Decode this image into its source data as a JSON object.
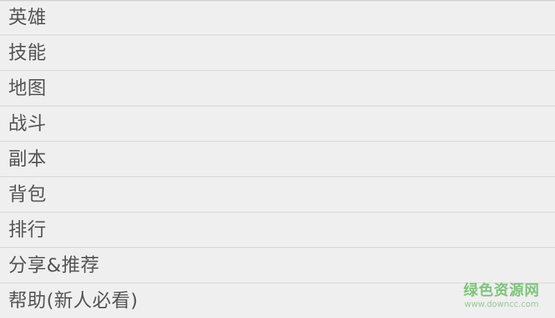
{
  "menu": {
    "items": [
      {
        "label": "英雄"
      },
      {
        "label": "技能"
      },
      {
        "label": "地图"
      },
      {
        "label": "战斗"
      },
      {
        "label": "副本"
      },
      {
        "label": "背包"
      },
      {
        "label": "排行"
      },
      {
        "label": "分享&推荐"
      },
      {
        "label": "帮助(新人必看)"
      }
    ]
  },
  "watermark": {
    "title": "绿色资源网",
    "url": "www.downcc.com"
  },
  "colors": {
    "background": "#efefef",
    "divider": "#d3d3d3",
    "text": "#555555",
    "watermark": "#7cc47a"
  }
}
